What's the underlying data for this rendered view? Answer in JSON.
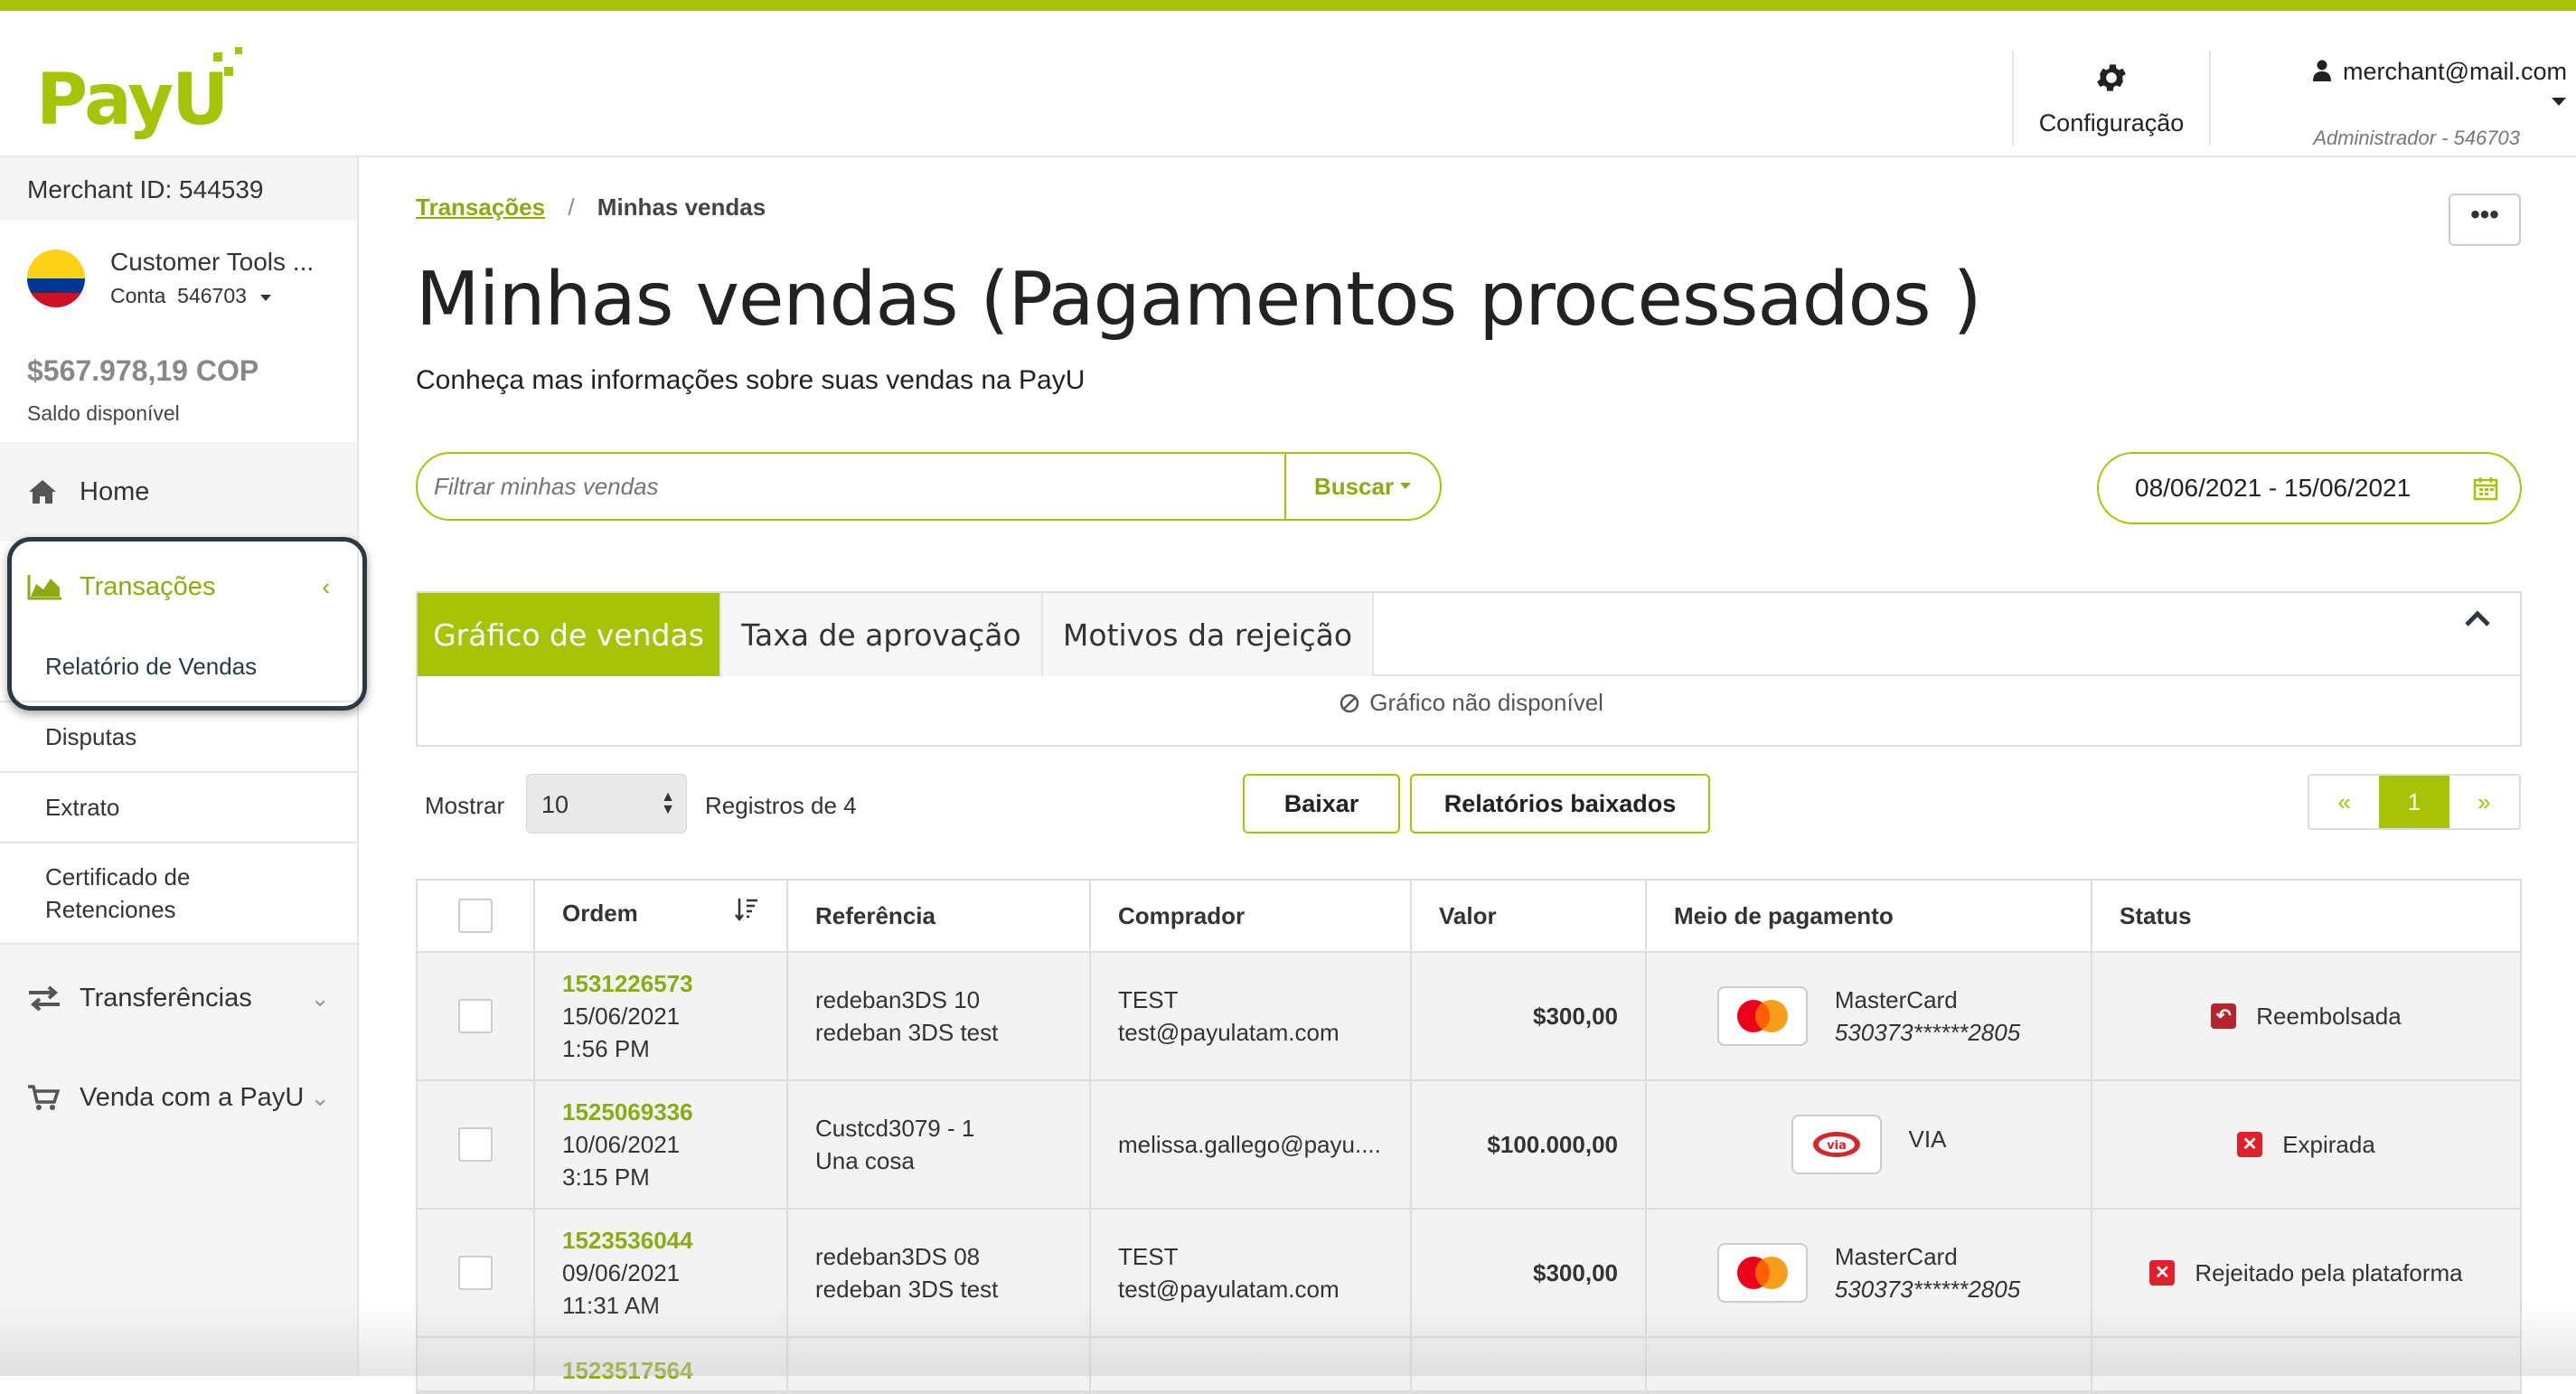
{
  "brand": {
    "logo_text": "PayU",
    "accent": "#a6c307"
  },
  "header": {
    "config_label": "Configuração",
    "user_email": "merchant@mail.com",
    "user_role": "Administrador - 546703"
  },
  "sidebar": {
    "merchant_id": "Merchant ID: 544539",
    "account_name": "Customer Tools ...",
    "account_conta": "Conta  546703",
    "balance": "$567.978,19 COP",
    "balance_label": "Saldo disponível",
    "home": "Home",
    "transacoes": "Transações",
    "sub_items": [
      "Relatório de Vendas",
      "Disputas",
      "Extrato",
      "Certificado de Retenciones"
    ],
    "transferencias": "Transferências",
    "venda": "Venda com a PayU"
  },
  "main": {
    "breadcrumb_link": "Transações",
    "breadcrumb_sep": "/",
    "breadcrumb_current": "Minhas vendas",
    "more_label": "•••",
    "title": "Minhas vendas (Pagamentos processados )",
    "subtitle": "Conheça mas informações sobre suas vendas na PayU",
    "search_placeholder": "Filtrar minhas vendas",
    "search_button": "Buscar",
    "date_range": "08/06/2021 - 15/06/2021",
    "tabs": [
      "Gráfico de vendas",
      "Taxa de aprovação",
      "Motivos da rejeição"
    ],
    "no_chart": "Gráfico não disponível",
    "mostrar": "Mostrar",
    "page_size": "10",
    "registros": "Registros de 4",
    "baixar": "Baixar",
    "relatorios": "Relatórios baixados",
    "pager": {
      "prev": "«",
      "current": "1",
      "next": "»"
    }
  },
  "table": {
    "headers": [
      "Ordem",
      "Referência",
      "Comprador",
      "Valor",
      "Meio de pagamento",
      "Status"
    ],
    "rows": [
      {
        "order": "1531226573",
        "date": "15/06/2021",
        "time": "1:56 PM",
        "ref1": "redeban3DS 10",
        "ref2": "redeban 3DS test",
        "buyer1": "TEST",
        "buyer2": "test@payulatam.com",
        "value": "$300,00",
        "pay": "MasterCard",
        "card": "530373******2805",
        "status": "Reembolsada"
      },
      {
        "order": "1525069336",
        "date": "10/06/2021",
        "time": "3:15 PM",
        "ref1": "Custcd3079 - 1",
        "ref2": "Una cosa",
        "buyer1": "melissa.gallego@payu....",
        "buyer2": "",
        "value": "$100.000,00",
        "pay": "VIA",
        "card": "",
        "status": "Expirada"
      },
      {
        "order": "1523536044",
        "date": "09/06/2021",
        "time": "11:31 AM",
        "ref1": "redeban3DS 08",
        "ref2": "redeban 3DS test",
        "buyer1": "TEST",
        "buyer2": "test@payulatam.com",
        "value": "$300,00",
        "pay": "MasterCard",
        "card": "530373******2805",
        "status": "Rejeitado pela plataforma"
      }
    ],
    "partial_order": "1523517564"
  }
}
